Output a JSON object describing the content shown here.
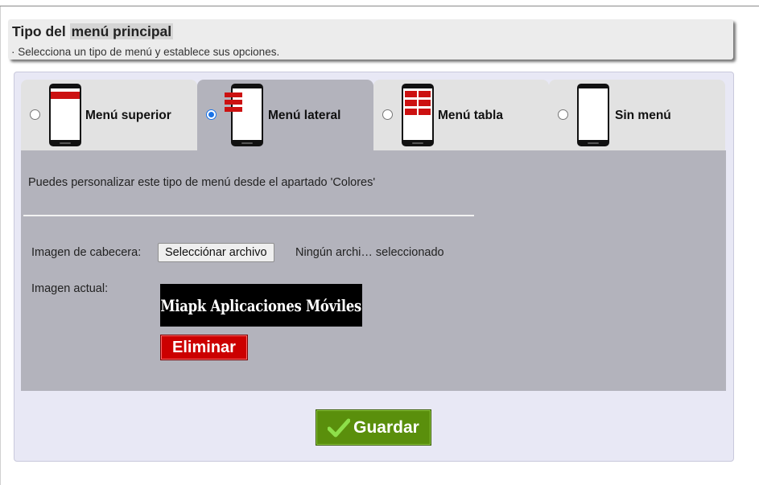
{
  "header": {
    "title_prefix": "Tipo del",
    "title_highlight": "menú principal",
    "subtitle": "· Selecciona un tipo de menú y establece sus opciones."
  },
  "tabs": [
    {
      "label": "Menú superior",
      "selected": false,
      "icon": "phone-top-menu-icon"
    },
    {
      "label": "Menú lateral",
      "selected": true,
      "icon": "phone-side-menu-icon"
    },
    {
      "label": "Menú tabla",
      "selected": false,
      "icon": "phone-grid-menu-icon"
    },
    {
      "label": "Sin menú",
      "selected": false,
      "icon": "phone-blank-icon"
    }
  ],
  "content": {
    "info": "Puedes personalizar este tipo de menú desde el apartado 'Colores'",
    "image_label": "Imagen de cabecera:",
    "file_button": "Selecciónar archivo",
    "file_status": "Ningún archi… seleccionado",
    "current_label": "Imagen actual:",
    "current_image_text": "Miapk Aplicaciones Móviles",
    "delete_button": "Eliminar"
  },
  "footer": {
    "save_button": "Guardar",
    "save_icon": "checkmark-icon"
  },
  "colors": {
    "accent_red": "#cc0000",
    "save_green": "#5a8f0c",
    "active_tab": "#b3b3bc",
    "inactive_tab": "#e2e2e2",
    "panel_bg": "#e8e8f5"
  }
}
